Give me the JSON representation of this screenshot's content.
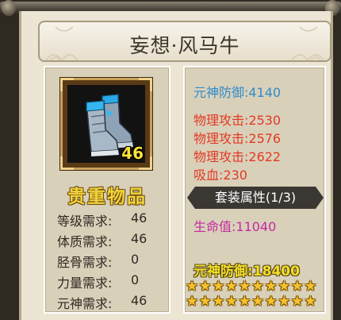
{
  "title": "妄想·风马牛",
  "item": {
    "icon": "boots-icon",
    "level_text": "46",
    "quality": "贵重物品"
  },
  "requirements": [
    {
      "label": "等级需求:",
      "value": "46"
    },
    {
      "label": "体质需求:",
      "value": "46"
    },
    {
      "label": "胫骨需求:",
      "value": "0"
    },
    {
      "label": "力量需求:",
      "value": "0"
    },
    {
      "label": "元神需求:",
      "value": "46"
    }
  ],
  "base_stat": "元神防御:4140",
  "extra_stats": [
    "物理攻击:2530",
    "物理攻击:2576",
    "物理攻击:2622",
    "吸血:230"
  ],
  "set_bonus": {
    "header": "套装属性(1/3)",
    "stat": "生命值:11040"
  },
  "star_bonus": {
    "stat": "元神防御:18400",
    "stars": 20
  },
  "colors": {
    "blue_stat": "#2f8bc8",
    "red_stat": "#e23a22",
    "magenta_stat": "#c42aa0",
    "gold": "#f1d33c",
    "parchment": "#ece5d3"
  }
}
